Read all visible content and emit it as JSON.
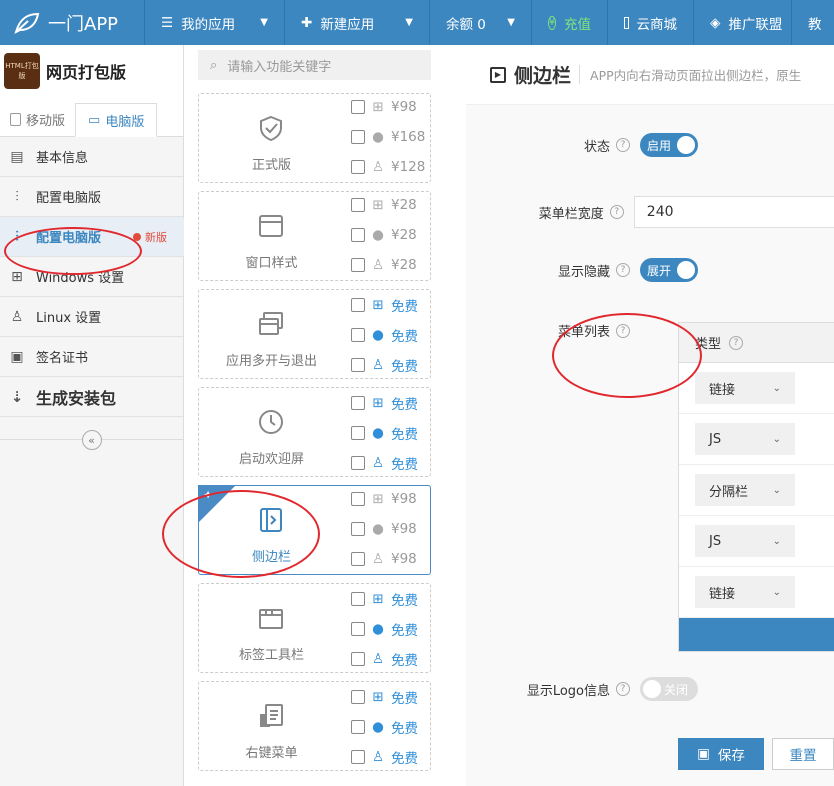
{
  "topbar": {
    "logo_text": "一门APP",
    "nav": [
      {
        "label": "我的应用",
        "icon": "list-icon",
        "dropdown": true
      },
      {
        "label": "新建应用",
        "icon": "plus-icon",
        "dropdown": true
      },
      {
        "label": "余额 0",
        "icon": "",
        "dropdown": true
      },
      {
        "label": "充值",
        "icon": "yen-circle-icon",
        "dropdown": false
      },
      {
        "label": "云商城",
        "icon": "shop-icon",
        "dropdown": false
      },
      {
        "label": "推广联盟",
        "icon": "diamond-icon",
        "dropdown": false
      },
      {
        "label": "教",
        "icon": "",
        "dropdown": false
      }
    ],
    "bg_color": "#3c87c0"
  },
  "sidebar": {
    "app_icon_text": "HTML打包版",
    "app_name": "网页打包版",
    "version_tabs": [
      {
        "label": "移动版",
        "icon": "mobile-icon",
        "active": false
      },
      {
        "label": "电脑版",
        "icon": "monitor-icon",
        "active": true
      }
    ],
    "items": [
      {
        "label": "基本信息",
        "icon": "doc-icon",
        "active": false
      },
      {
        "label": "配置电脑版",
        "icon": "sliders-icon",
        "active": false
      },
      {
        "label": "配置电脑版",
        "icon": "sliders-icon",
        "active": true,
        "badge": "新版"
      },
      {
        "label": "Windows 设置",
        "icon": "windows-icon",
        "active": false
      },
      {
        "label": "Linux 设置",
        "icon": "linux-icon",
        "active": false
      },
      {
        "label": "签名证书",
        "icon": "certificate-icon",
        "active": false
      },
      {
        "label": "生成安装包",
        "icon": "sort-numeric-icon",
        "active": false
      }
    ],
    "collapse_label": "«"
  },
  "functions": {
    "search_placeholder": "请输入功能关键字",
    "cards": [
      {
        "label": "正式版",
        "icon": "shield-check-icon",
        "selected": false,
        "prices": [
          {
            "os": "windows-icon",
            "text": "¥98",
            "free": false
          },
          {
            "os": "apple-icon",
            "text": "¥168",
            "free": false
          },
          {
            "os": "linux-icon",
            "text": "¥128",
            "free": false
          }
        ]
      },
      {
        "label": "窗口样式",
        "icon": "window-icon",
        "selected": false,
        "prices": [
          {
            "os": "windows-icon",
            "text": "¥28",
            "free": false
          },
          {
            "os": "apple-icon",
            "text": "¥28",
            "free": false
          },
          {
            "os": "linux-icon",
            "text": "¥28",
            "free": false
          }
        ]
      },
      {
        "label": "应用多开与退出",
        "icon": "multi-window-icon",
        "selected": false,
        "prices": [
          {
            "os": "windows-icon",
            "text": "免费",
            "free": true
          },
          {
            "os": "apple-icon",
            "text": "免费",
            "free": true
          },
          {
            "os": "linux-icon",
            "text": "免费",
            "free": true
          }
        ]
      },
      {
        "label": "启动欢迎屏",
        "icon": "clock-icon",
        "selected": false,
        "prices": [
          {
            "os": "windows-icon",
            "text": "免费",
            "free": true
          },
          {
            "os": "apple-icon",
            "text": "免费",
            "free": true
          },
          {
            "os": "linux-icon",
            "text": "免费",
            "free": true
          }
        ]
      },
      {
        "label": "侧边栏",
        "icon": "sidebar-expand-icon",
        "selected": true,
        "prices": [
          {
            "os": "windows-icon",
            "text": "¥98",
            "free": false
          },
          {
            "os": "apple-icon",
            "text": "¥98",
            "free": false
          },
          {
            "os": "linux-icon",
            "text": "¥98",
            "free": false
          }
        ]
      },
      {
        "label": "标签工具栏",
        "icon": "tabs-icon",
        "selected": false,
        "prices": [
          {
            "os": "windows-icon",
            "text": "免费",
            "free": true
          },
          {
            "os": "apple-icon",
            "text": "免费",
            "free": true
          },
          {
            "os": "linux-icon",
            "text": "免费",
            "free": true
          }
        ]
      },
      {
        "label": "右键菜单",
        "icon": "context-menu-icon",
        "selected": false,
        "prices": [
          {
            "os": "windows-icon",
            "text": "免费",
            "free": true
          },
          {
            "os": "apple-icon",
            "text": "免费",
            "free": true
          },
          {
            "os": "linux-icon",
            "text": "免费",
            "free": true
          }
        ]
      }
    ]
  },
  "content": {
    "title": "侧边栏",
    "description": "APP内向右滑动页面拉出侧边栏，原生",
    "fields": {
      "status_label": "状态",
      "status_value": "启用",
      "width_label": "菜单栏宽度",
      "width_value": "240",
      "show_hidden_label": "显示隐藏",
      "show_hidden_value": "展开",
      "menu_list_label": "菜单列表",
      "logo_label": "显示Logo信息",
      "logo_value": "关闭"
    },
    "menu_table": {
      "column_header": "类型",
      "rows": [
        "链接",
        "JS",
        "分隔栏",
        "JS",
        "链接"
      ]
    },
    "buttons": {
      "save": "保存",
      "reset": "重置"
    }
  }
}
